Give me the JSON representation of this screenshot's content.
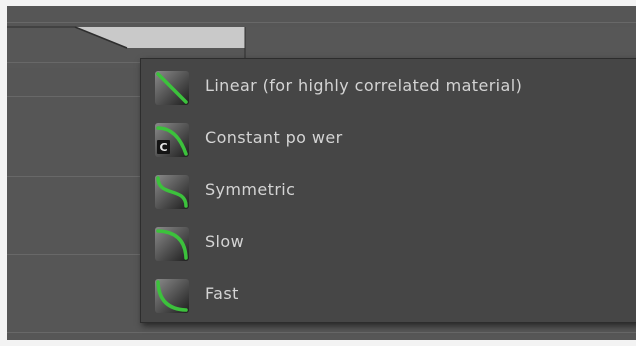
{
  "menu": {
    "items": [
      {
        "label": "Linear (for highly correlated material)",
        "icon": "linear-curve-icon",
        "badge": ""
      },
      {
        "label": "Constant po wer",
        "icon": "constant-power-curve-icon",
        "badge": "C"
      },
      {
        "label": "Symmetric",
        "icon": "symmetric-curve-icon",
        "badge": ""
      },
      {
        "label": "Slow",
        "icon": "slow-curve-icon",
        "badge": ""
      },
      {
        "label": "Fast",
        "icon": "fast-curve-icon",
        "badge": ""
      }
    ]
  },
  "colors": {
    "accent": "#3cc23c",
    "menu_background": "#464646",
    "panel_background": "#565656",
    "text": "#d4d4d4"
  }
}
